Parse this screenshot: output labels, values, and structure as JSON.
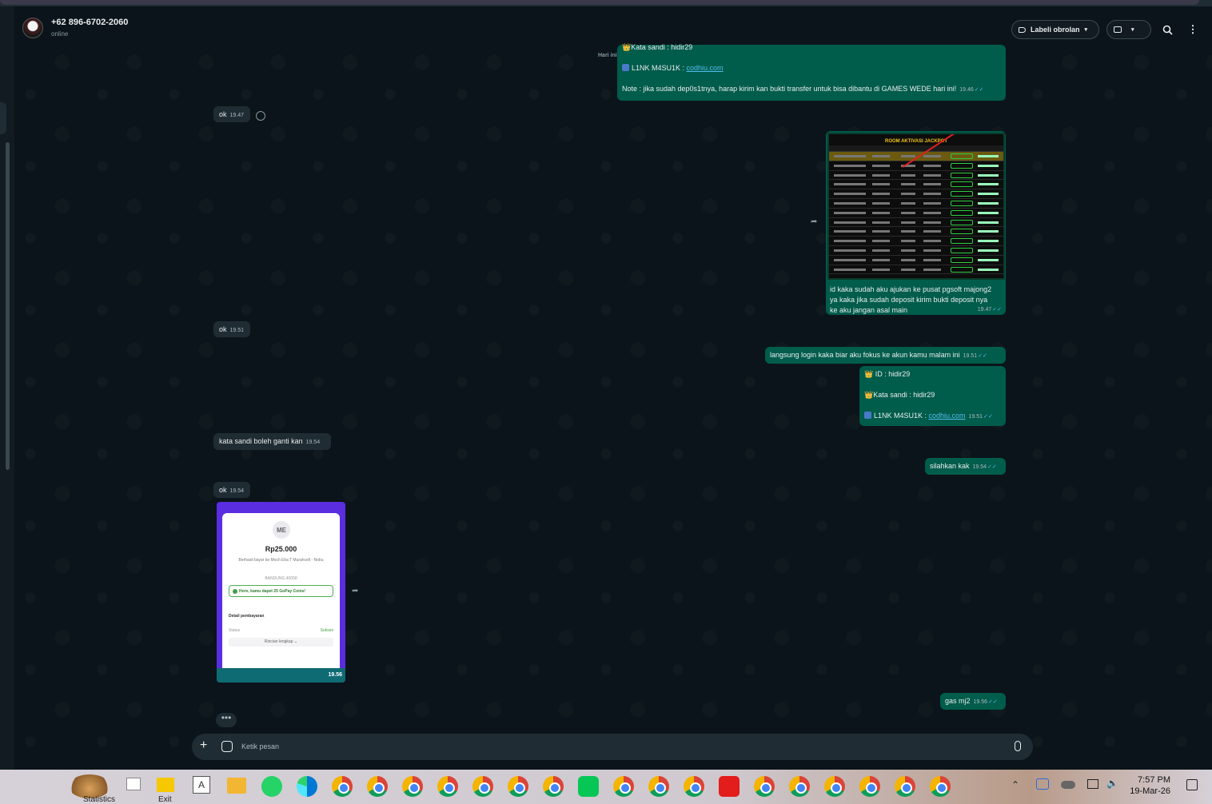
{
  "header": {
    "contact_name": "+62 896-6702-2060",
    "contact_status": "online",
    "label_button": "Labeli obrolan"
  },
  "day_label": "Hari ini",
  "messages": {
    "m1_line1": "Kata sandi : hidir29",
    "m1_line2_prefix": "L1NK M4SU1K : ",
    "m1_link": "codhiu.com",
    "m1_line3": "Note : jika sudah dep0s1tnya, harap kirim kan bukti transfer untuk bisa dibantu di GAMES WEDE hari ini!",
    "m1_time": "19.46",
    "m2_text": "ok",
    "m2_time": "19.47",
    "jackpot_title": "ROOM AKTIVASI JACKPOT",
    "m3_line1": "id kaka sudah aku ajukan ke pusat pgsoft majong2",
    "m3_line2": "ya kaka jika sudah deposit kirim bukti deposit nya",
    "m3_line3": "ke aku jangan asal main",
    "m3_time": "19.47",
    "m4_text": "ok",
    "m4_time": "19.51",
    "m5_text": "langsung login kaka biar aku fokus ke akun kamu malam ini",
    "m5_time": "19.51",
    "m6_line1": "ID :  hidir29",
    "m6_line2": "Kata sandi : hidir29",
    "m6_line3_prefix": "L1NK M4SU1K : ",
    "m6_link": "codhiu.com",
    "m6_time": "19.51",
    "m7_text": "kata sandi boleh ganti kan",
    "m7_time": "19.54",
    "m8_text": "silahkan kak",
    "m8_time": "19.54",
    "m9_text": "ok",
    "m9_time": "19.54",
    "m10_time": "19.56",
    "m11_text": "gas mj2",
    "m11_time": "19.56"
  },
  "receipt": {
    "badge": "ME",
    "amount": "Rp25.000",
    "desc": "Berhasil bayar ke Moch Eka T Murahcell - Nobu",
    "location": "BANDUNG.40058",
    "coins": "Hore, kamu dapet 25 GoPay Coins!",
    "detail": "Detail pembayaran",
    "status_label": "Status",
    "status_value": "Sukses",
    "rincian": "Rincian lengkap ⌄"
  },
  "compose": {
    "placeholder": "Ketik pesan"
  },
  "taskbar": {
    "statistics": "Statistics",
    "exit": "Exit",
    "time": "7:57 PM",
    "date": "19-Mar-26"
  },
  "colors": {
    "bg": "#0b141a",
    "incoming": "#202c33",
    "outgoing": "#005c4b",
    "link": "#53bdeb"
  }
}
